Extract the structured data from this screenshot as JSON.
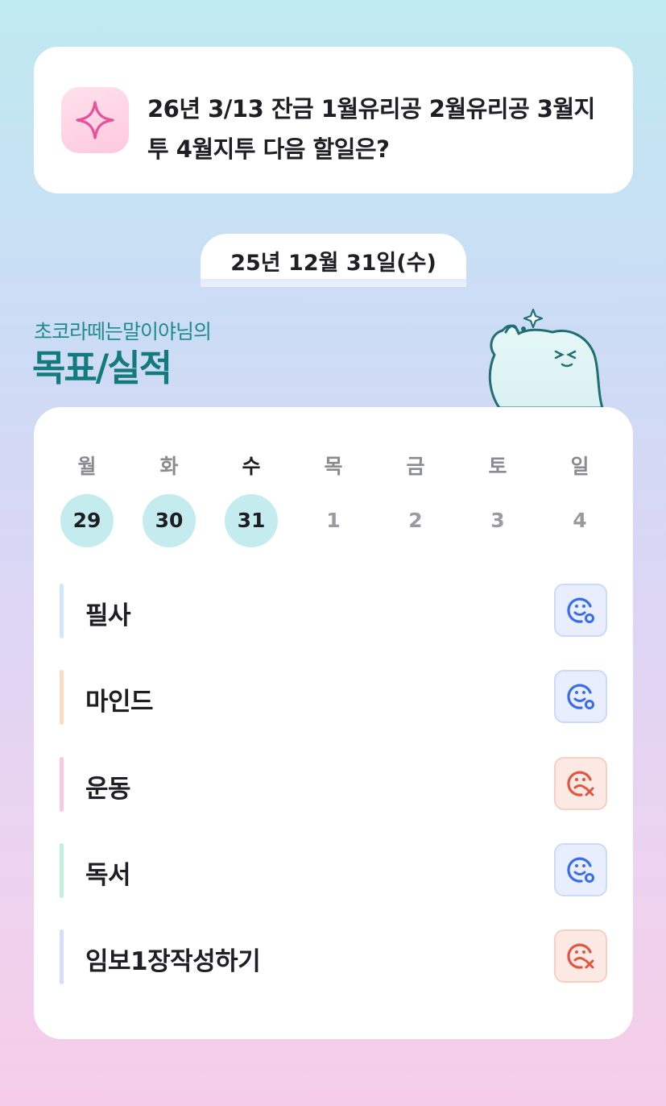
{
  "question": {
    "icon": "sparkle-icon",
    "text": "26년 3/13 잔금 1월유리공 2월유리공 3월지투 4월지투 다음 할일은?"
  },
  "date_label": "25년 12월 31일(수)",
  "header": {
    "owner_line": "초코라떼는말이야님의",
    "title": "목표/실적"
  },
  "week": {
    "days": [
      {
        "name": "월",
        "num": "29",
        "active": true
      },
      {
        "name": "화",
        "num": "30",
        "active": true
      },
      {
        "name": "수",
        "num": "31",
        "active": true,
        "today": true
      },
      {
        "name": "목",
        "num": "1",
        "active": false
      },
      {
        "name": "금",
        "num": "2",
        "active": false
      },
      {
        "name": "토",
        "num": "3",
        "active": false
      },
      {
        "name": "일",
        "num": "4",
        "active": false
      }
    ]
  },
  "tasks": [
    {
      "label": "필사",
      "color": "#cfe6fb",
      "status": "done",
      "icon": "smile-check-icon"
    },
    {
      "label": "마인드",
      "color": "#fbdcc0",
      "status": "done",
      "icon": "smile-check-icon"
    },
    {
      "label": "운동",
      "color": "#f8c9e2",
      "status": "miss",
      "icon": "frown-x-icon"
    },
    {
      "label": "독서",
      "color": "#bff0dc",
      "status": "done",
      "icon": "smile-check-icon"
    },
    {
      "label": "임보1장작성하기",
      "color": "#d3defa",
      "status": "miss",
      "icon": "frown-x-icon"
    }
  ],
  "colors": {
    "accent_teal": "#137a7d",
    "done_blue": "#3a6cf0",
    "miss_red": "#e2563f",
    "active_day_bg": "#c4ecef"
  }
}
